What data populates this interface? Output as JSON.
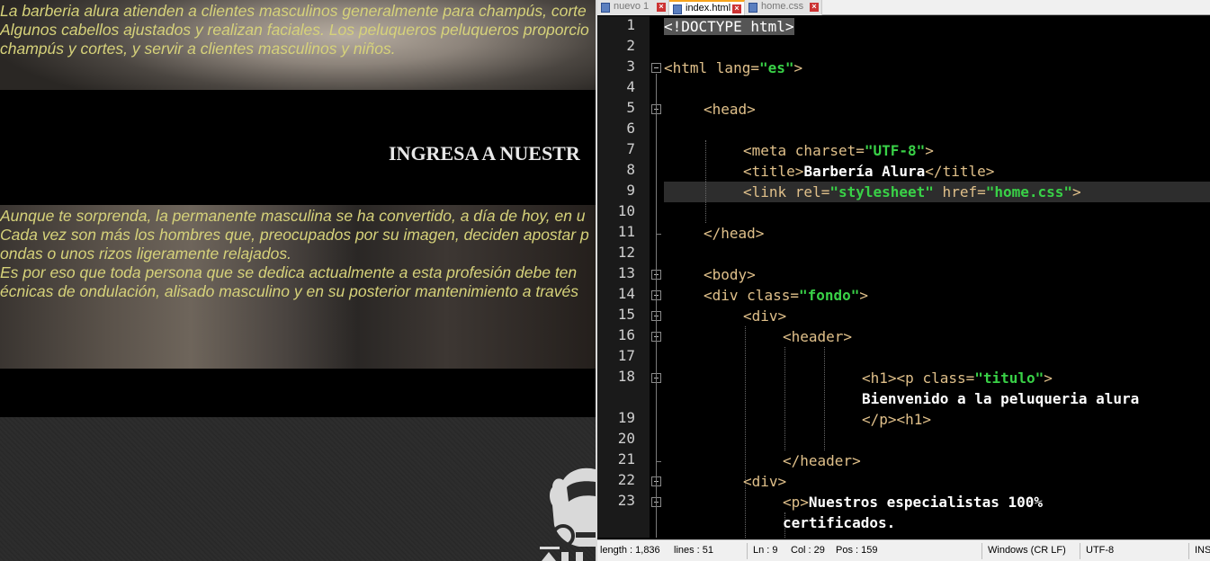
{
  "browser": {
    "band1_lines": [
      "La barberia alura atienden a clientes masculinos generalmente para champús, corte",
      "Algunos cabellos ajustados y realizan faciales. Los peluqueros peluqueros proporcio",
      "champús y cortes, y servir a clientes masculinos y niños."
    ],
    "section_heading": "INGRESA A NUESTR",
    "band2_lines": [
      "Aunque te sorprenda, la permanente masculina se ha convertido, a día de hoy, en u",
      "Cada vez son más los hombres que, preocupados por su imagen, deciden apostar p",
      "ondas o unos rizos ligeramente relajados.",
      "Es por eso que toda persona que se dedica actualmente a esta profesión debe ten",
      "écnicas de ondulación, alisado masculino y en su posterior mantenimiento a través"
    ]
  },
  "editor": {
    "tabs": [
      {
        "label": "nuevo 1",
        "active": false
      },
      {
        "label": "index.html",
        "active": true
      },
      {
        "label": "home.css",
        "active": false
      }
    ],
    "line_numbers": [
      "1",
      "2",
      "3",
      "4",
      "5",
      "6",
      "7",
      "8",
      "9",
      "10",
      "11",
      "12",
      "13",
      "14",
      "15",
      "16",
      "17",
      "18",
      "",
      "19",
      "20",
      "21",
      "22",
      "23",
      ""
    ],
    "code": {
      "l1": "<!DOCTYPE html>",
      "l3_tag": "<html ",
      "l3_attr": "lang=",
      "l3_val": "\"es\"",
      "l3_close": ">",
      "l5": "<head>",
      "l7_tag": "<meta ",
      "l7_attr": "charset=",
      "l7_val": "\"UTF-8\"",
      "l7_close": ">",
      "l8_open": "<title>",
      "l8_text": "Barbería Alura",
      "l8_close": "</title>",
      "l9_tag": "<link ",
      "l9_attr1": "rel=",
      "l9_val1": "\"stylesheet\"",
      "l9_attr2": " href=",
      "l9_val2": "\"home.css\"",
      "l9_close": ">",
      "l11": "</head>",
      "l13": "<body>",
      "l14_tag": "<div ",
      "l14_attr": "class=",
      "l14_val": "\"fondo\"",
      "l14_close": ">",
      "l15": "<div>",
      "l16": "<header>",
      "l18_open": "<h1><p ",
      "l18_attr": "class=",
      "l18_val": "\"titulo\"",
      "l18_close": ">",
      "l18_text": "Bienvenido a la peluqueria alura",
      "l19": "</p><h1>",
      "l21": "</header>",
      "l22": "<div>",
      "l23_open": "<p>",
      "l23_text": "Nuestros especialistas 100%",
      "l23_text2": "certificados."
    }
  },
  "statusbar": {
    "length": "length : 1,836",
    "lines": "lines : 51",
    "ln": "Ln : 9",
    "col": "Col : 29",
    "pos": "Pos : 159",
    "eol": "Windows (CR LF)",
    "encoding": "UTF-8",
    "mode": "INS"
  }
}
